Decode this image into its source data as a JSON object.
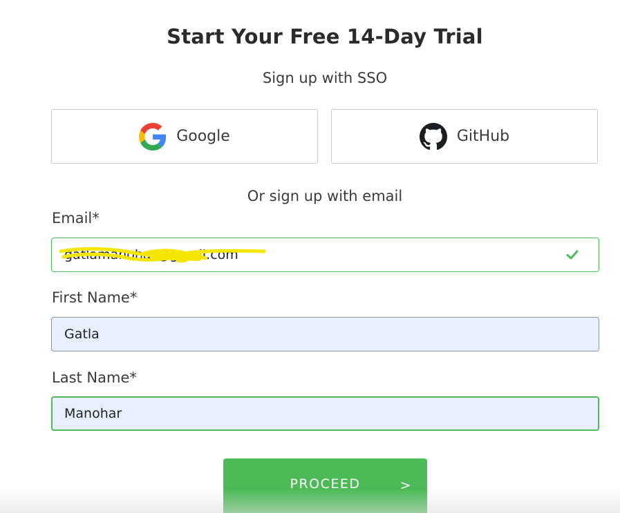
{
  "header": {
    "title": "Start Your Free 14-Day Trial",
    "sso_subtitle": "Sign up with SSO"
  },
  "sso": {
    "google": {
      "label": "Google",
      "icon": "google-icon"
    },
    "github": {
      "label": "GitHub",
      "icon": "github-icon"
    }
  },
  "divider": "Or sign up with email",
  "form": {
    "email": {
      "label": "Email*",
      "value": "gatlamanohar@gmail.com",
      "valid": true
    },
    "first_name": {
      "label": "First Name*",
      "value": "Gatla"
    },
    "last_name": {
      "label": "Last Name*",
      "value": "Manohar"
    }
  },
  "proceed": {
    "label": "PROCEED",
    "arrow": ">"
  },
  "colors": {
    "accent_green": "#4cbb57",
    "autofill_bg": "#e8f0fe",
    "redaction_yellow": "#f5e600"
  }
}
